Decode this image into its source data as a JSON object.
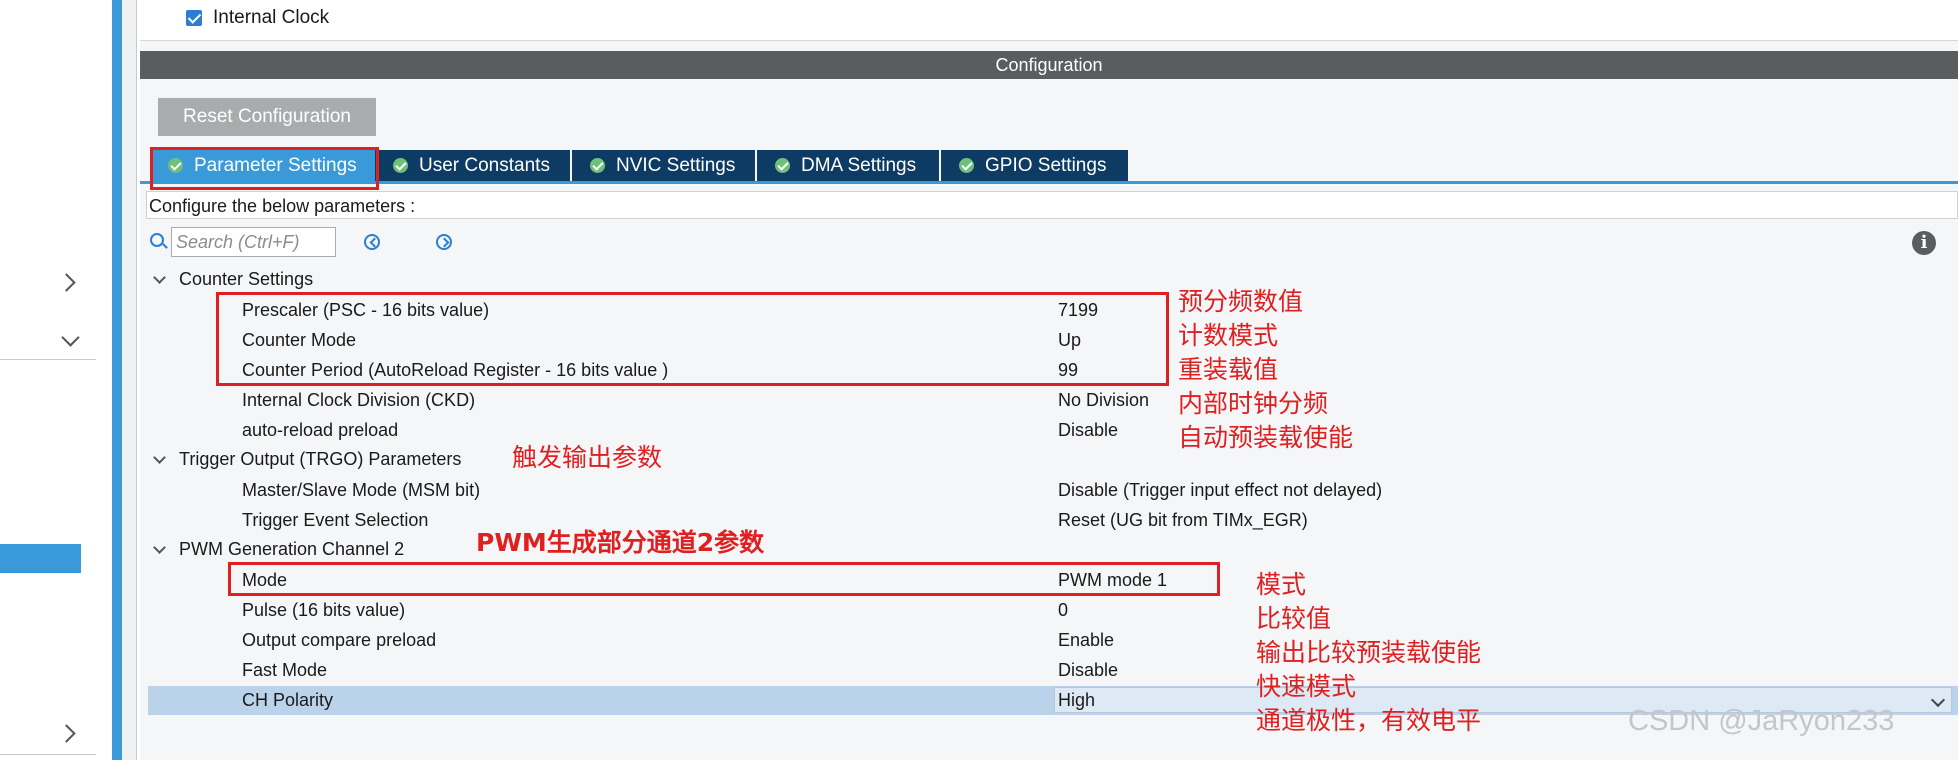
{
  "top": {
    "internal_clock_label": "Internal Clock",
    "internal_clock_checked": true
  },
  "config_header": "Configuration",
  "reset_button": "Reset Configuration",
  "tabs": [
    {
      "label": "Parameter Settings",
      "active": true
    },
    {
      "label": "User Constants",
      "active": false
    },
    {
      "label": "NVIC Settings",
      "active": false
    },
    {
      "label": "DMA Settings",
      "active": false
    },
    {
      "label": "GPIO Settings",
      "active": false
    }
  ],
  "configure_text": "Configure the below parameters :",
  "search": {
    "placeholder": "Search (Ctrl+F)"
  },
  "groups": {
    "counter": {
      "label": "Counter Settings",
      "params": [
        {
          "name": "Prescaler (PSC - 16 bits value)",
          "value": "7199"
        },
        {
          "name": "Counter Mode",
          "value": "Up"
        },
        {
          "name": "Counter Period (AutoReload Register - 16 bits value )",
          "value": "99"
        },
        {
          "name": "Internal Clock Division (CKD)",
          "value": "No Division"
        },
        {
          "name": "auto-reload preload",
          "value": "Disable"
        }
      ]
    },
    "trgo": {
      "label": "Trigger Output (TRGO) Parameters",
      "params": [
        {
          "name": "Master/Slave Mode (MSM bit)",
          "value": "Disable (Trigger input effect not delayed)"
        },
        {
          "name": "Trigger Event Selection",
          "value": "Reset (UG bit from TIMx_EGR)"
        }
      ]
    },
    "pwm": {
      "label": "PWM Generation Channel 2",
      "params": [
        {
          "name": "Mode",
          "value": "PWM mode 1"
        },
        {
          "name": "Pulse (16 bits value)",
          "value": "0"
        },
        {
          "name": "Output compare preload",
          "value": "Enable"
        },
        {
          "name": "Fast Mode",
          "value": "Disable"
        },
        {
          "name": "CH Polarity",
          "value": "High"
        }
      ]
    }
  },
  "annotations": {
    "counter_notes": [
      "预分频数值",
      "计数模式",
      "重装载值",
      "内部时钟分频",
      "自动预装载使能"
    ],
    "trgo_note": "触发输出参数",
    "pwm_note": "PWM生成部分通道2参数",
    "pwm_notes": [
      "模式",
      "比较值",
      "输出比较预装载使能",
      "快速模式",
      "通道极性，有效电平"
    ]
  },
  "watermark": "CSDN @JaRyon233",
  "colors": {
    "accent_blue": "#3a9ad9",
    "tab_dark": "#0e3b63",
    "header_gray": "#5a5c5e",
    "annotation_red": "#e02020",
    "selected_row": "#bad3ea"
  }
}
